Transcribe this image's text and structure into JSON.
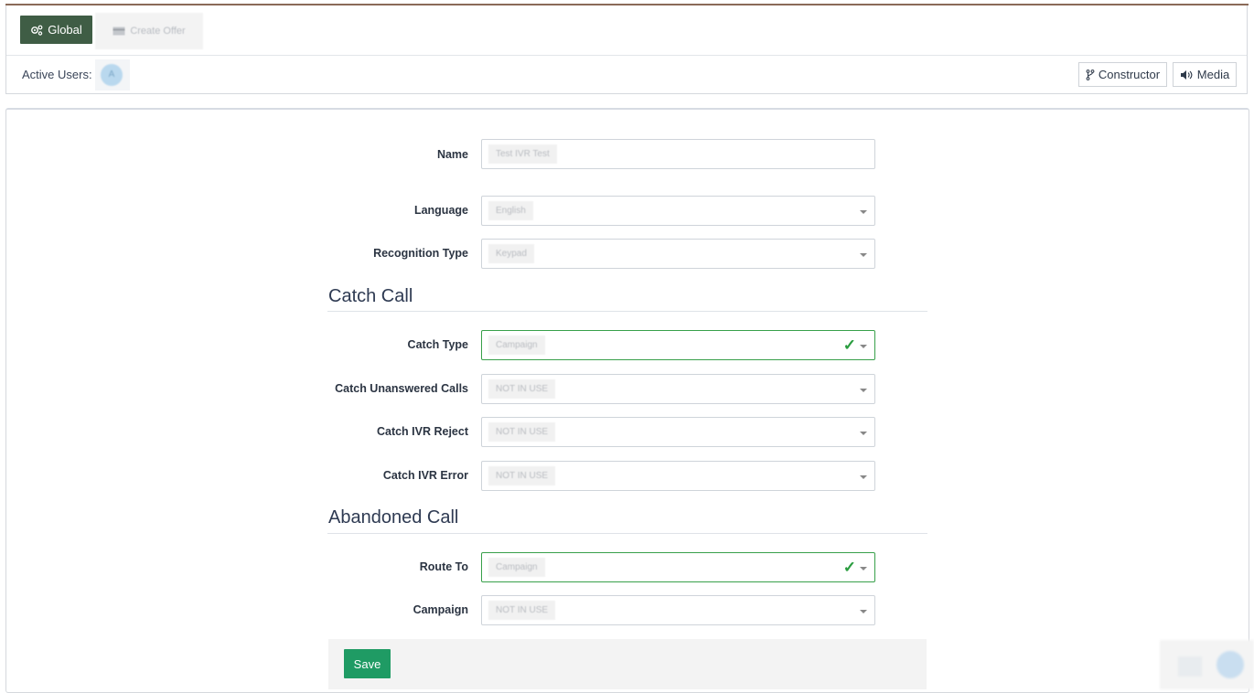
{
  "tabs": [
    {
      "label": "Global",
      "icon": "settings-icon",
      "active": true
    },
    {
      "label": "Create Offer",
      "icon": "card-icon",
      "active": false
    }
  ],
  "active_users": {
    "label": "Active Users:",
    "avatar_initial": "A"
  },
  "toolbar": {
    "constructor_label": "Constructor",
    "media_label": "Media"
  },
  "form": {
    "fields": {
      "name": {
        "label": "Name",
        "value": "Test IVR Test"
      },
      "language": {
        "label": "Language",
        "value": "English"
      },
      "recognition_type": {
        "label": "Recognition Type",
        "value": "Keypad"
      }
    },
    "sections": {
      "catch_call": {
        "title": "Catch Call",
        "catch_type": {
          "label": "Catch Type",
          "value": "Campaign"
        },
        "catch_unanswered": {
          "label": "Catch Unanswered Calls",
          "value": "NOT IN USE"
        },
        "catch_ivr_reject": {
          "label": "Catch IVR Reject",
          "value": "NOT IN USE"
        },
        "catch_ivr_error": {
          "label": "Catch IVR Error",
          "value": "NOT IN USE"
        }
      },
      "abandoned_call": {
        "title": "Abandoned Call",
        "route_to": {
          "label": "Route To",
          "value": "Campaign"
        },
        "campaign": {
          "label": "Campaign",
          "value": "NOT IN USE"
        }
      }
    },
    "save_label": "Save"
  },
  "colors": {
    "primary_tab": "#3f5d45",
    "save": "#1f9b64",
    "valid": "#38a04a"
  }
}
